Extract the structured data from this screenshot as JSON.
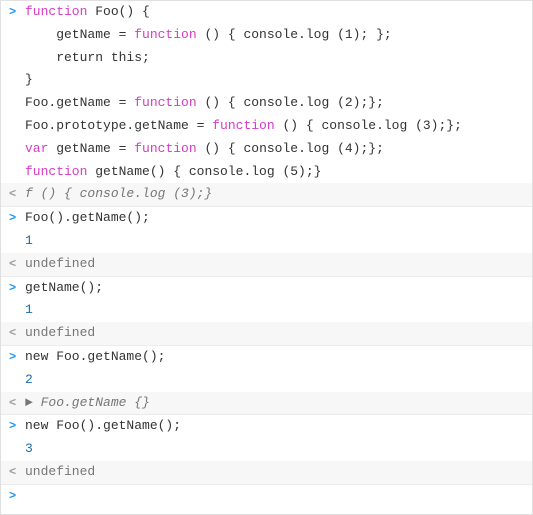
{
  "console": {
    "lines": [
      {
        "type": "input",
        "prompt": ">",
        "segments": [
          {
            "text": "function",
            "class": "kw"
          },
          {
            "text": " Foo() {",
            "class": "plain"
          }
        ]
      },
      {
        "type": "input-cont",
        "prompt": "",
        "segments": [
          {
            "text": "    getName = ",
            "class": "plain"
          },
          {
            "text": "function",
            "class": "kw"
          },
          {
            "text": " () { console.log (1); };",
            "class": "plain"
          }
        ]
      },
      {
        "type": "input-cont",
        "prompt": "",
        "segments": [
          {
            "text": "    return this;",
            "class": "plain"
          }
        ]
      },
      {
        "type": "input-cont",
        "prompt": "",
        "segments": [
          {
            "text": "}",
            "class": "plain"
          }
        ]
      },
      {
        "type": "input-cont",
        "prompt": "",
        "segments": [
          {
            "text": "Foo.getName = ",
            "class": "plain"
          },
          {
            "text": "function",
            "class": "kw"
          },
          {
            "text": " () { console.log (2);};",
            "class": "plain"
          }
        ]
      },
      {
        "type": "input-cont",
        "prompt": "",
        "segments": [
          {
            "text": "Foo.prototype.getName = ",
            "class": "plain"
          },
          {
            "text": "function",
            "class": "kw"
          },
          {
            "text": " () { console.log (3);};",
            "class": "plain"
          }
        ]
      },
      {
        "type": "input-cont",
        "prompt": "",
        "segments": [
          {
            "text": "var",
            "class": "kw"
          },
          {
            "text": " getName = ",
            "class": "plain"
          },
          {
            "text": "function",
            "class": "kw"
          },
          {
            "text": " () { console.log (4);};",
            "class": "plain"
          }
        ]
      },
      {
        "type": "input-cont",
        "prompt": "",
        "segments": [
          {
            "text": "function",
            "class": "kw"
          },
          {
            "text": " getName() { console.log (5);}",
            "class": "plain"
          }
        ]
      },
      {
        "type": "result",
        "prompt": "<",
        "segments": [
          {
            "text": "f () { console.log (3);}",
            "class": "italic-gray"
          }
        ]
      },
      {
        "type": "input",
        "prompt": ">",
        "segments": [
          {
            "text": "Foo().getName();",
            "class": "plain"
          }
        ]
      },
      {
        "type": "output-val",
        "prompt": "",
        "segments": [
          {
            "text": "1",
            "class": "result-val"
          }
        ]
      },
      {
        "type": "result",
        "prompt": "<",
        "segments": [
          {
            "text": "undefined",
            "class": "gray"
          }
        ]
      },
      {
        "type": "input",
        "prompt": ">",
        "segments": [
          {
            "text": "getName();",
            "class": "plain"
          }
        ]
      },
      {
        "type": "output-val",
        "prompt": "",
        "segments": [
          {
            "text": "1",
            "class": "result-val"
          }
        ]
      },
      {
        "type": "result",
        "prompt": "<",
        "segments": [
          {
            "text": "undefined",
            "class": "gray"
          }
        ]
      },
      {
        "type": "input",
        "prompt": ">",
        "segments": [
          {
            "text": "new Foo.getName();",
            "class": "plain"
          }
        ]
      },
      {
        "type": "output-val",
        "prompt": "",
        "segments": [
          {
            "text": "2",
            "class": "result-val"
          }
        ]
      },
      {
        "type": "result",
        "prompt": "<",
        "segments": [
          {
            "text": "▶ Foo.getName {}",
            "class": "italic-gray"
          }
        ]
      },
      {
        "type": "input",
        "prompt": ">",
        "segments": [
          {
            "text": "new Foo().getName();",
            "class": "plain"
          }
        ]
      },
      {
        "type": "output-val",
        "prompt": "",
        "segments": [
          {
            "text": "3",
            "class": "result-val"
          }
        ]
      },
      {
        "type": "result",
        "prompt": "<",
        "segments": [
          {
            "text": "undefined",
            "class": "gray"
          }
        ]
      },
      {
        "type": "input-empty",
        "prompt": ">",
        "segments": []
      }
    ]
  }
}
